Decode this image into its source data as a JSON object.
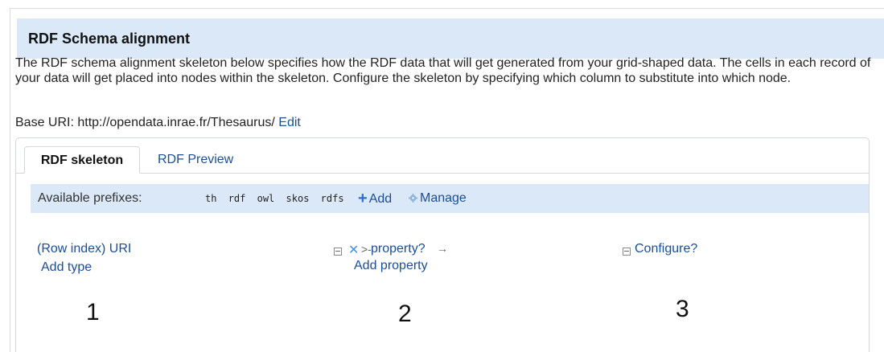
{
  "dialog": {
    "title": "RDF Schema alignment",
    "description": "The RDF schema alignment skeleton below specifies how the RDF data that will get generated from your grid-shaped data. The cells in each record of your data will get placed into nodes within the skeleton. Configure the skeleton by specifying which column to substitute into which node.",
    "base_uri_label": "Base URI: http://opendata.inrae.fr/Thesaurus/",
    "base_uri_edit": "Edit"
  },
  "tabs": [
    {
      "label": "RDF skeleton",
      "active": true
    },
    {
      "label": "RDF Preview",
      "active": false
    }
  ],
  "prefixes": {
    "label": "Available prefixes:",
    "items": [
      "th",
      "rdf",
      "owl",
      "skos",
      "rdfs"
    ],
    "add_label": "Add",
    "manage_label": "Manage"
  },
  "skeleton": {
    "subject_node": "(Row index) URI",
    "add_type": "Add type",
    "property": "property?",
    "add_property": "Add property",
    "object_node": "Configure?"
  },
  "annotations": [
    "1",
    "2",
    "3"
  ],
  "colors": {
    "header_bg": "#dbe8f8",
    "link": "#1a4e95",
    "plus": "#2a6fd6"
  }
}
